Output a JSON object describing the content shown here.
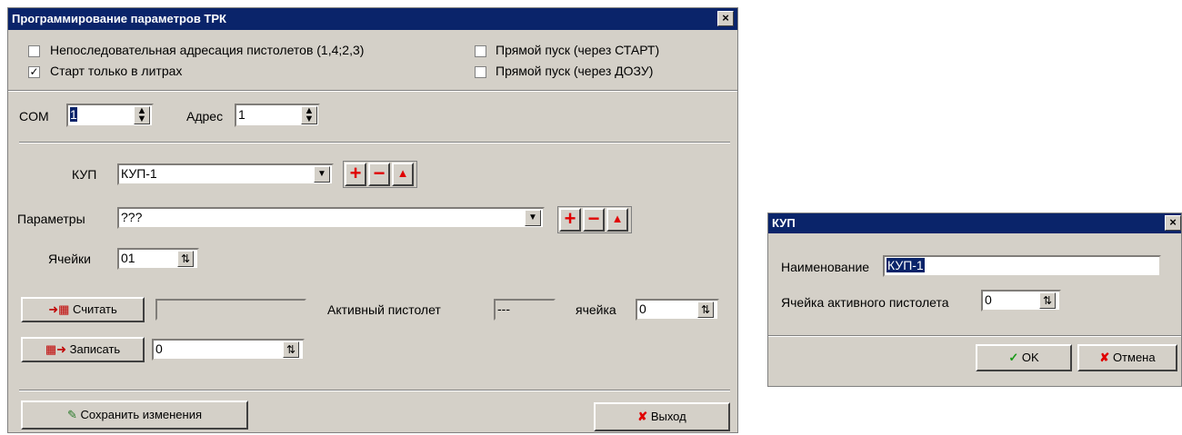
{
  "main": {
    "title": "Программирование параметров ТРК",
    "close_glyph": "×",
    "options": {
      "nonseq_label": "Непоследовательная адресация пистолетов (1,4;2,3)",
      "nonseq_checked": false,
      "liters_label": "Старт только в литрах",
      "liters_checked": true,
      "direct_start_label": "Прямой пуск (через СТАРТ)",
      "direct_start_checked": false,
      "direct_dozu_label": "Прямой пуск (через ДОЗУ)",
      "direct_dozu_checked": false
    },
    "com_label": "COM",
    "com_value": "1",
    "addr_label": "Адрес",
    "addr_value": "1",
    "kup_label": "КУП",
    "kup_value": "КУП-1",
    "params_label": "Параметры",
    "params_value": "???",
    "cells_label": "Ячейки",
    "cells_value": "01",
    "read_button": "Считать",
    "read_value": "",
    "active_gun_label": "Активный пистолет",
    "active_gun_value": "---",
    "cell_label": "ячейка",
    "cell_value": "0",
    "write_button": "Записать",
    "write_value": "0",
    "save_button": "Сохранить изменения",
    "exit_button": "Выход",
    "plus_glyph": "+",
    "minus_glyph": "−",
    "up_glyph": "▲"
  },
  "kup_dialog": {
    "title": "КУП",
    "close_glyph": "×",
    "name_label": "Наименование",
    "name_value": "КУП-1",
    "active_cell_label": "Ячейка активного пистолета",
    "active_cell_value": "0",
    "ok_button": "OK",
    "cancel_button": "Отмена"
  },
  "icons": {
    "check": "✓",
    "cross": "✘",
    "spin_up": "▲",
    "spin_down": "▼",
    "dropdown": "▼"
  },
  "colors": {
    "title_bar": "#0a246a",
    "window_bg": "#d4d0c8",
    "accent_red": "#e00000",
    "ok_green": "#1a9a1a"
  }
}
